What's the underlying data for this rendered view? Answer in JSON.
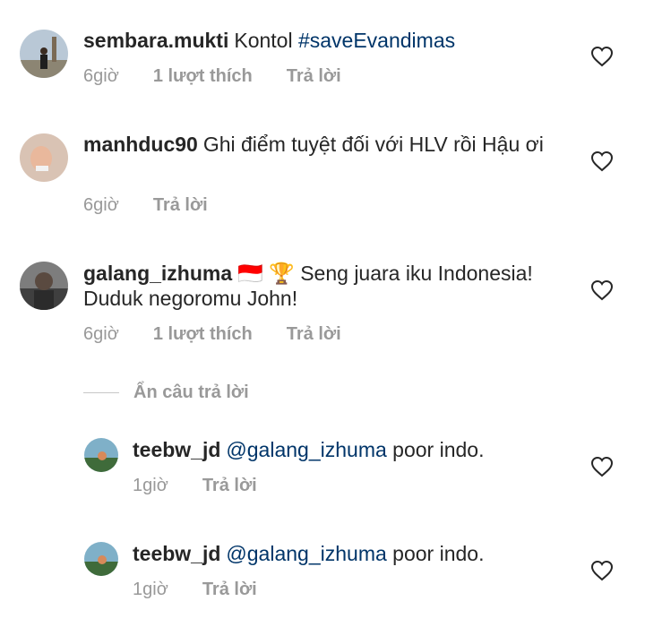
{
  "comments": [
    {
      "username": "sembara.mukti",
      "text": "Kontol ",
      "hashtag": "#saveEvandimas",
      "time": "6giờ",
      "likes": "1 lượt thích",
      "reply": "Trả lời"
    },
    {
      "username": "manhduc90",
      "text": "Ghi điểm tuyệt đối với HLV rồi Hậu ơi",
      "time": "6giờ",
      "reply": "Trả lời"
    },
    {
      "username": "galang_izhuma",
      "emoji": "🇮🇩 🏆",
      "text": "Seng juara iku Indonesia! Duduk negoromu John!",
      "time": "6giờ",
      "likes": "1 lượt thích",
      "reply": "Trả lời"
    }
  ],
  "hide_replies": "Ẩn câu trả lời",
  "replies": [
    {
      "username": "teebw_jd",
      "mention": "@galang_izhuma",
      "text": " poor indo.",
      "time": "1giờ",
      "reply": "Trả lời"
    },
    {
      "username": "teebw_jd",
      "mention": "@galang_izhuma",
      "text": " poor indo.",
      "time": "1giờ",
      "reply": "Trả lời"
    }
  ],
  "colors": {
    "text": "#262626",
    "meta": "#999999",
    "link": "#003569"
  },
  "icons": {
    "like": "heart-outline-icon"
  }
}
